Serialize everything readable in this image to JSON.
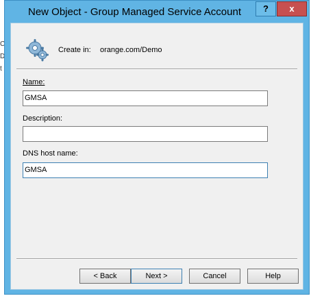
{
  "background_fragments": [
    "«",
    "C",
    "D",
    "t"
  ],
  "window": {
    "title": "New Object - Group Managed Service Account",
    "help_label": "?",
    "close_label": "x"
  },
  "header": {
    "create_in_label": "Create in:",
    "create_in_path": "orange.com/Demo"
  },
  "form": {
    "name_label": "Name:",
    "name_value": "GMSA",
    "description_label": "Description:",
    "description_value": "",
    "dns_label": "DNS host name:",
    "dns_value": "GMSA"
  },
  "buttons": {
    "back": "< Back",
    "next": "Next >",
    "cancel": "Cancel",
    "help": "Help"
  },
  "colors": {
    "title_bar": "#60b4e4",
    "close_button": "#c75050",
    "dialog_body": "#f0f0f0"
  }
}
